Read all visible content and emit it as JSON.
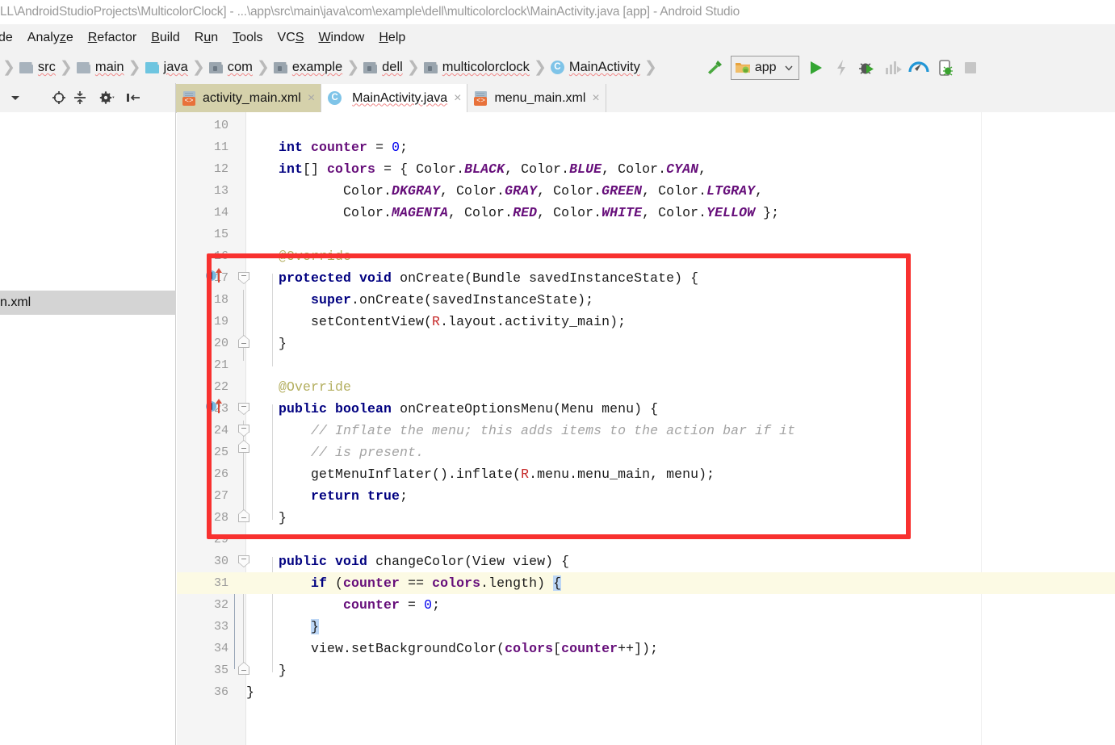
{
  "window": {
    "title": "LL\\AndroidStudioProjects\\MulticolorClock] - ...\\app\\src\\main\\java\\com\\example\\dell\\multicolorclock\\MainActivity.java [app] - Android Studio"
  },
  "menubar": {
    "items": [
      {
        "label": "de",
        "mnemonic": ""
      },
      {
        "label": "Analyze",
        "mnemonic": "z"
      },
      {
        "label": "Refactor",
        "mnemonic": "R"
      },
      {
        "label": "Build",
        "mnemonic": "B"
      },
      {
        "label": "Run",
        "mnemonic": "u"
      },
      {
        "label": "Tools",
        "mnemonic": "T"
      },
      {
        "label": "VCS",
        "mnemonic": "S"
      },
      {
        "label": "Window",
        "mnemonic": "W"
      },
      {
        "label": "Help",
        "mnemonic": "H"
      }
    ]
  },
  "breadcrumb": {
    "items": [
      {
        "label": "src",
        "icon": "folder-icon"
      },
      {
        "label": "main",
        "icon": "folder-icon"
      },
      {
        "label": "java",
        "icon": "folder-java-icon"
      },
      {
        "label": "com",
        "icon": "package-icon"
      },
      {
        "label": "example",
        "icon": "package-icon"
      },
      {
        "label": "dell",
        "icon": "package-icon"
      },
      {
        "label": "multicolorclock",
        "icon": "package-icon"
      },
      {
        "label": "MainActivity",
        "icon": "java-class-icon"
      }
    ]
  },
  "toolbar": {
    "build_icon": "hammer-icon",
    "run_config": {
      "label": "app",
      "icon": "android-module-icon",
      "chevron": "chevron-down-icon"
    },
    "run_icon": "run-play-icon",
    "apply_changes_icon": "lightning-bolt-icon",
    "debug_icon": "debug-bug-icon",
    "run_profile_icon": "profiler-bars-icon",
    "profiler_icon": "profiler-gauge-icon",
    "attach_debugger_icon": "attach-debugger-phone-icon",
    "stop_icon": "stop-square-icon"
  },
  "left_tools": {
    "items": [
      {
        "icon": "chevron-down-icon"
      },
      {
        "icon": "locate-target-icon"
      },
      {
        "icon": "collapse-all-icon"
      },
      {
        "icon": "gear-icon"
      },
      {
        "icon": "hide-panel-icon"
      }
    ]
  },
  "tabs": [
    {
      "label": "activity_main.xml",
      "icon": "xml-layout-icon",
      "state": "inactive-olive",
      "close": "×"
    },
    {
      "label": "MainActivity.java",
      "icon": "java-class-icon",
      "state": "active",
      "close": "×"
    },
    {
      "label": "menu_main.xml",
      "icon": "xml-layout-icon",
      "state": "inactive",
      "close": "×"
    }
  ],
  "project_panel": {
    "tooltip_label": "n.xml"
  },
  "editor": {
    "filename": "MainActivity.java",
    "first_line": 10,
    "highlighted_line": 31,
    "colors": {
      "keyword": "#000080",
      "number": "#0000ee",
      "comment": "#a3a3a3",
      "annotation": "#b3ae5e",
      "field": "#660e7a",
      "constant": "#660e7a",
      "resource": "#c62828",
      "caret_row_bg": "#fcfae4",
      "brace_match_bg": "#bcd6f5",
      "annotation_rect": "#f8312f"
    },
    "lines": [
      {
        "n": 10,
        "text": ""
      },
      {
        "n": 11,
        "text": "    int counter = 0;"
      },
      {
        "n": 12,
        "text": "    int[] colors = { Color.BLACK, Color.BLUE, Color.CYAN,"
      },
      {
        "n": 13,
        "text": "            Color.DKGRAY, Color.GRAY, Color.GREEN, Color.LTGRAY,"
      },
      {
        "n": 14,
        "text": "            Color.MAGENTA, Color.RED, Color.WHITE, Color.YELLOW };"
      },
      {
        "n": 15,
        "text": ""
      },
      {
        "n": 16,
        "text": "    @Override"
      },
      {
        "n": 17,
        "text": "    protected void onCreate(Bundle savedInstanceState) {"
      },
      {
        "n": 18,
        "text": "        super.onCreate(savedInstanceState);"
      },
      {
        "n": 19,
        "text": "        setContentView(R.layout.activity_main);"
      },
      {
        "n": 20,
        "text": "    }"
      },
      {
        "n": 21,
        "text": ""
      },
      {
        "n": 22,
        "text": "    @Override"
      },
      {
        "n": 23,
        "text": "    public boolean onCreateOptionsMenu(Menu menu) {"
      },
      {
        "n": 24,
        "text": "        // Inflate the menu; this adds items to the action bar if it"
      },
      {
        "n": 25,
        "text": "        // is present."
      },
      {
        "n": 26,
        "text": "        getMenuInflater().inflate(R.menu.menu_main, menu);"
      },
      {
        "n": 27,
        "text": "        return true;"
      },
      {
        "n": 28,
        "text": "    }"
      },
      {
        "n": 29,
        "text": ""
      },
      {
        "n": 30,
        "text": "    public void changeColor(View view) {"
      },
      {
        "n": 31,
        "text": "        if (counter == colors.length) {"
      },
      {
        "n": 32,
        "text": "            counter = 0;"
      },
      {
        "n": 33,
        "text": "        }"
      },
      {
        "n": 34,
        "text": "        view.setBackgroundColor(colors[counter++]);"
      },
      {
        "n": 35,
        "text": "    }"
      },
      {
        "n": 36,
        "text": "}"
      }
    ],
    "gutter_markers": [
      {
        "line": 17,
        "type": "override-method-marker"
      },
      {
        "line": 23,
        "type": "override-method-marker"
      }
    ]
  }
}
